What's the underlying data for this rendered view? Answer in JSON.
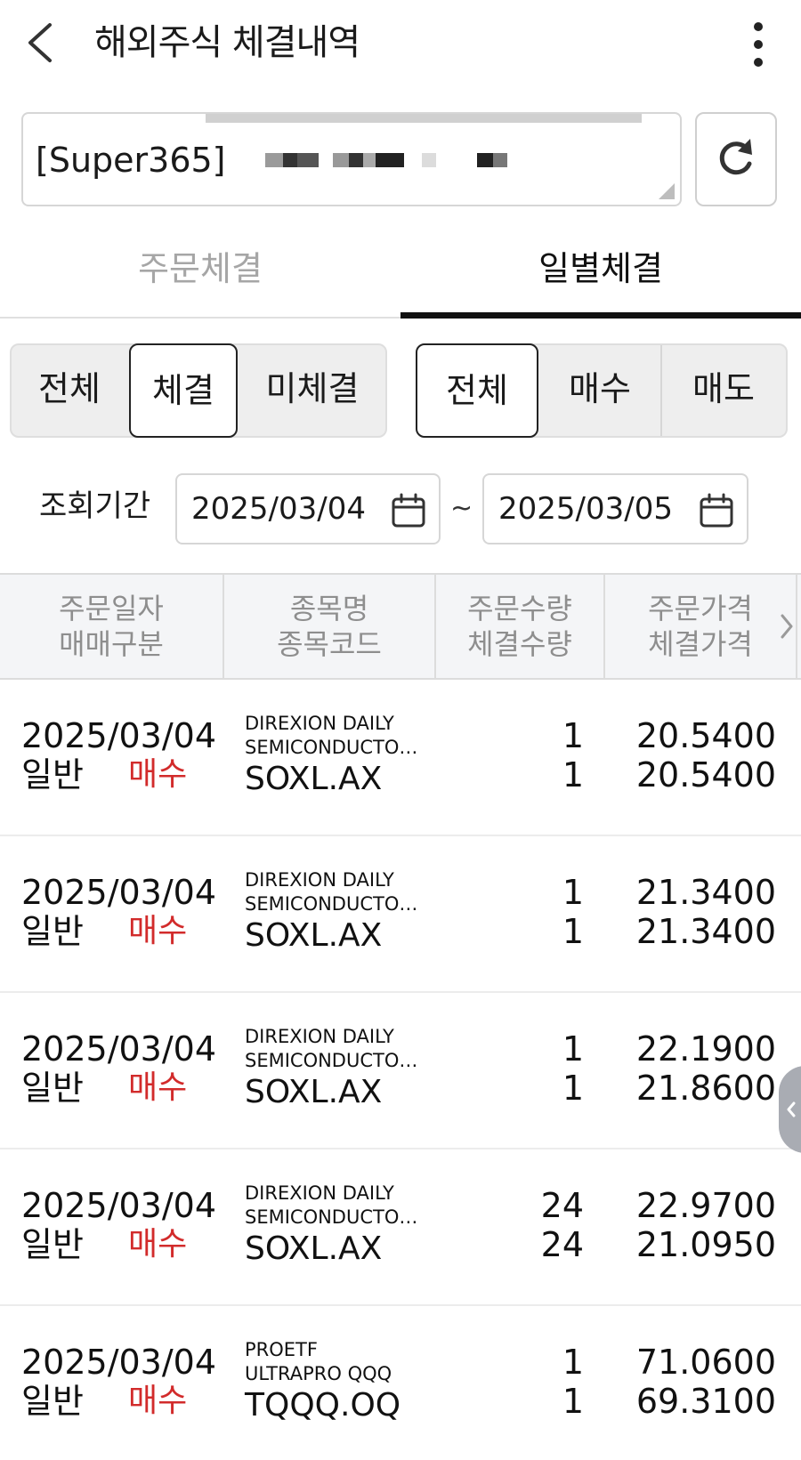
{
  "header": {
    "title": "해외주식 체결내역",
    "back_icon": "chevron-left-icon",
    "more_icon": "more-vertical-icon"
  },
  "account": {
    "prefix": "[Super365]"
  },
  "tabs": [
    {
      "label": "주문체결",
      "active": false
    },
    {
      "label": "일별체결",
      "active": true
    }
  ],
  "filters": {
    "status": [
      {
        "label": "전체",
        "active": false
      },
      {
        "label": "체결",
        "active": true
      },
      {
        "label": "미체결",
        "active": false
      }
    ],
    "side": [
      {
        "label": "전체",
        "active": true
      },
      {
        "label": "매수",
        "active": false
      },
      {
        "label": "매도",
        "active": false
      }
    ]
  },
  "period": {
    "label": "조회기간",
    "from": "2025/03/04",
    "separator": "~",
    "to": "2025/03/05"
  },
  "table": {
    "headers": [
      {
        "line1": "주문일자",
        "line2": "매매구분"
      },
      {
        "line1": "종목명",
        "line2": "종목코드"
      },
      {
        "line1": "주문수량",
        "line2": "체결수량"
      },
      {
        "line1": "주문가격",
        "line2": "체결가격"
      }
    ],
    "rows": [
      {
        "date": "2025/03/04",
        "kind": "일반",
        "side": "매수",
        "name1": "DIREXION DAILY",
        "name2": "SEMICONDUCTO…",
        "code": "SOXL.AX",
        "order_qty": "1",
        "filled_qty": "1",
        "order_price": "20.5400",
        "filled_price": "20.5400"
      },
      {
        "date": "2025/03/04",
        "kind": "일반",
        "side": "매수",
        "name1": "DIREXION DAILY",
        "name2": "SEMICONDUCTO…",
        "code": "SOXL.AX",
        "order_qty": "1",
        "filled_qty": "1",
        "order_price": "21.3400",
        "filled_price": "21.3400"
      },
      {
        "date": "2025/03/04",
        "kind": "일반",
        "side": "매수",
        "name1": "DIREXION DAILY",
        "name2": "SEMICONDUCTO…",
        "code": "SOXL.AX",
        "order_qty": "1",
        "filled_qty": "1",
        "order_price": "22.1900",
        "filled_price": "21.8600"
      },
      {
        "date": "2025/03/04",
        "kind": "일반",
        "side": "매수",
        "name1": "DIREXION DAILY",
        "name2": "SEMICONDUCTO…",
        "code": "SOXL.AX",
        "order_qty": "24",
        "filled_qty": "24",
        "order_price": "22.9700",
        "filled_price": "21.0950"
      },
      {
        "date": "2025/03/04",
        "kind": "일반",
        "side": "매수",
        "name1": "PROETF",
        "name2": "ULTRAPRO QQQ",
        "code": "TQQQ.OQ",
        "order_qty": "1",
        "filled_qty": "1",
        "order_price": "71.0600",
        "filled_price": "69.3100"
      }
    ]
  },
  "colors": {
    "buy": "#d22b2b",
    "active_underline": "#111111",
    "header_bg": "#f4f5f7"
  }
}
